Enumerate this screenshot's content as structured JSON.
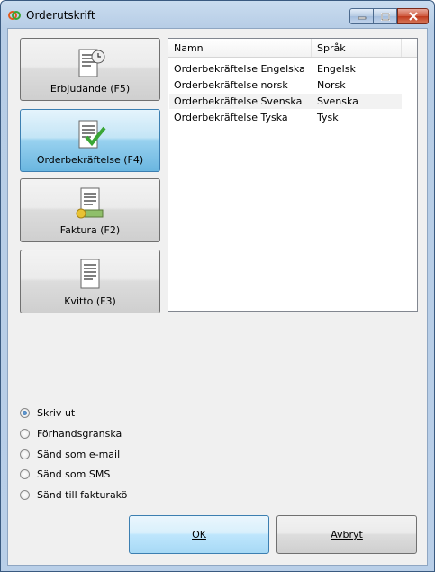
{
  "window": {
    "title": "Orderutskrift"
  },
  "buttons_left": [
    {
      "label": "Erbjudande (F5)",
      "icon": "clock-document-icon"
    },
    {
      "label": "Orderbekräftelse (F4)",
      "icon": "check-document-icon",
      "active": true
    },
    {
      "label": "Faktura (F2)",
      "icon": "money-document-icon"
    },
    {
      "label": "Kvitto (F3)",
      "icon": "receipt-document-icon"
    }
  ],
  "list": {
    "columns": [
      "Namn",
      "Språk"
    ],
    "rows": [
      {
        "name": "Orderbekräftelse Engelska",
        "lang": "Engelsk"
      },
      {
        "name": "Orderbekräftelse norsk",
        "lang": "Norsk"
      },
      {
        "name": "Orderbekräftelse Svenska",
        "lang": "Svenska",
        "selected": true
      },
      {
        "name": "Orderbekräftelse Tyska",
        "lang": "Tysk"
      }
    ]
  },
  "options": {
    "selected": "Skriv ut",
    "items": [
      "Skriv ut",
      "Förhandsgranska",
      "Sänd som e-mail",
      "Sänd som SMS",
      "Sänd till fakturakö"
    ]
  },
  "footer": {
    "ok": "OK",
    "cancel": "Avbryt"
  },
  "colors": {
    "accent": "#3c7fb1",
    "titlebar": "#b9cfe8"
  }
}
